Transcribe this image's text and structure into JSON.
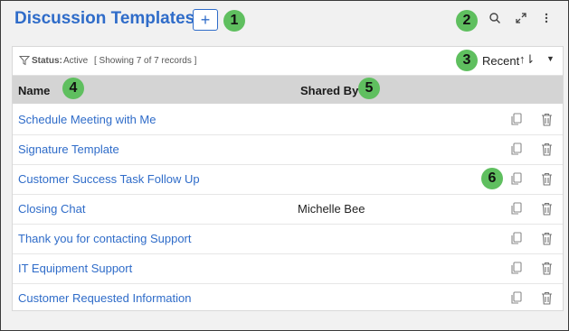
{
  "header": {
    "title": "Discussion Templates",
    "add_symbol": "+",
    "search_icon": "search-icon",
    "expand_icon": "expand-icon",
    "more_icon": "more-vertical-icon"
  },
  "callouts": [
    "1",
    "2",
    "3",
    "4",
    "5",
    "6"
  ],
  "filter": {
    "status_label": "Status:",
    "status_value": "Active",
    "showing_text": "[ Showing 7 of 7 records ]",
    "sort_label": "Recent",
    "sort_icon_text": "↑⇂",
    "sort_caret": "▼"
  },
  "table": {
    "columns": [
      "Name",
      "Shared By"
    ],
    "rows": [
      {
        "name": "Schedule Meeting with Me",
        "shared_by": ""
      },
      {
        "name": "Signature Template",
        "shared_by": ""
      },
      {
        "name": "Customer Success Task Follow Up",
        "shared_by": ""
      },
      {
        "name": "Closing Chat",
        "shared_by": "Michelle Bee"
      },
      {
        "name": "Thank you for contacting Support",
        "shared_by": ""
      },
      {
        "name": "IT Equipment Support",
        "shared_by": ""
      },
      {
        "name": "Customer Requested Information",
        "shared_by": ""
      }
    ],
    "row_icons": [
      "copy-icon",
      "trash-icon"
    ]
  },
  "colors": {
    "accent": "#2f6cc9",
    "callout": "#5fbf5f",
    "header_row": "#d4d4d4"
  }
}
